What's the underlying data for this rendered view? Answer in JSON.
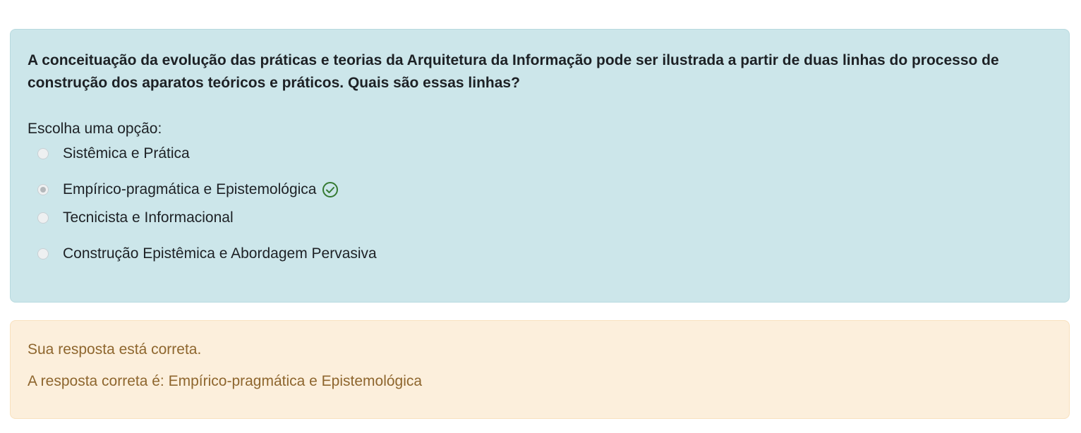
{
  "question": {
    "text": "A conceituação da evolução das práticas e teorias da Arquitetura da Informação pode ser ilustrada a partir de duas linhas do processo de construção dos aparatos teóricos e práticos. Quais são essas linhas?",
    "prompt": "Escolha uma opção:",
    "options": [
      {
        "label": "Sistêmica e Prática",
        "selected": false
      },
      {
        "label": "Empírico-pragmática e Epistemológica",
        "selected": true,
        "status": "correct"
      },
      {
        "label": "Tecnicista e Informacional",
        "selected": false
      },
      {
        "label": "Construção Epistêmica e Abordagem Pervasiva",
        "selected": false
      }
    ]
  },
  "feedback": {
    "status_text": "Sua resposta está correta.",
    "correct_answer_text": "A resposta correta é: Empírico-pragmática e Epistemológica"
  },
  "colors": {
    "question_bg": "#cce6ea",
    "feedback_bg": "#fcefdc",
    "feedback_text": "#8e662e",
    "correct_icon": "#357a32"
  },
  "icons": {
    "correct": "check-circle-icon"
  }
}
